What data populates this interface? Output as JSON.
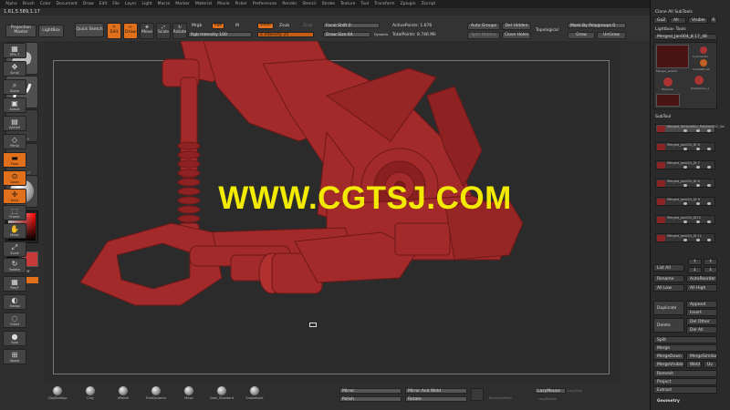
{
  "menu": [
    "Alpha",
    "Brush",
    "Color",
    "Document",
    "Draw",
    "Edit",
    "File",
    "Layer",
    "Light",
    "Macro",
    "Marker",
    "Material",
    "Movie",
    "Picker",
    "Preferences",
    "Render",
    "Stencil",
    "Stroke",
    "Texture",
    "Tool",
    "Transform",
    "Zplugin",
    "Zscript"
  ],
  "coords": "1.61,5.589,1.17",
  "top": {
    "projection_master": "Projection Master",
    "lightbox": "LightBox",
    "quick_sketch": "Quick Sketch",
    "edit": "Edit",
    "draw": "Draw",
    "move": "Move",
    "scale": "Scale",
    "rotate": "Rotate",
    "mrgb": "Mrgb",
    "rgb": "Rgb",
    "m": "M",
    "zadd": "Zadd",
    "zsub": "Zsub",
    "zcut": "Zcut",
    "rgb_intensity": "Rgb Intensity 100",
    "z_intensity": "Z Intensity 25",
    "focal_shift": "Focal Shift 0",
    "draw_size": "Draw Size 64",
    "dynamic": "Dynamic",
    "active_points": "ActivePoints: 1.676",
    "total_points": "TotalPoints: 8.746 Mil",
    "auto_groups": "Auto Groups",
    "split_hidden": "Split Hidden",
    "del_hidden": "Del Hidden",
    "close_holes": "Close Holes",
    "topological": "Topological",
    "mask_by_polygroups": "Mask By Polygroups 0",
    "grow": "Grow",
    "ungrow": "UnGrow"
  },
  "left": {
    "alpha_off": "Alpha Off",
    "texture_off": "Texture Off",
    "gradient": "Gradient",
    "switch_color": "SwitchColor",
    "alternate": "Alternate"
  },
  "watermark": "WWW.CGTSJ.COM",
  "right_shelf": [
    {
      "label": "SPix 3",
      "glyph": "▦",
      "active": false
    },
    {
      "label": "Scroll",
      "glyph": "✥",
      "active": false
    },
    {
      "label": "Zoom",
      "glyph": "⌕",
      "active": false
    },
    {
      "label": "Actual",
      "glyph": "▣",
      "active": false
    },
    {
      "label": "AAHalf",
      "glyph": "▤",
      "active": false
    },
    {
      "label": "Persp",
      "glyph": "◇",
      "active": false
    },
    {
      "label": "Floor",
      "glyph": "▬",
      "active": true
    },
    {
      "label": "Local",
      "glyph": "⊙",
      "active": true
    },
    {
      "label": "Gxyz",
      "glyph": "✛",
      "active": true
    },
    {
      "label": "Frame",
      "glyph": "⬚",
      "active": false
    },
    {
      "label": "Move",
      "glyph": "✋",
      "active": false
    },
    {
      "label": "Scale",
      "glyph": "⤢",
      "active": false
    },
    {
      "label": "Rotate",
      "glyph": "↻",
      "active": false
    },
    {
      "label": "PolyF",
      "glyph": "▦",
      "active": false
    },
    {
      "label": "Transp",
      "glyph": "◐",
      "active": false
    },
    {
      "label": "Ghost",
      "glyph": "◌",
      "active": false
    },
    {
      "label": "Solo",
      "glyph": "●",
      "active": false
    },
    {
      "label": "Xpose",
      "glyph": "⊞",
      "active": false
    }
  ],
  "panel": {
    "clone_all": "Clone All SubTools",
    "goz": "GoZ",
    "all": "All",
    "visible": "Visible",
    "r": "R",
    "lightbox_tools": "Lightbox› Tools",
    "current_tool": "Merged_Jan004_8.17_48",
    "tools": [
      "Merged_Jan004",
      "Cylinder3D",
      "ZSphere",
      "SimpleBrush",
      "PolySphere_1",
      "Merged_Jan004"
    ],
    "subtool": "SubTool",
    "subtools": [
      "Merged_VerticalSnr_Position002_Sel",
      "Merged_Jan004_DI 6",
      "Merged_Jan004_DI 7",
      "Merged_Jan004_DI 8",
      "Merged_Jan004_DI 9",
      "Merged_Jan004_Di10",
      "Merged_Jan004_DI 11"
    ],
    "list_all": "List All",
    "rename": "Rename",
    "auto_reorder": "AutoReorder",
    "all_low": "All Low",
    "all_high": "All High",
    "duplicate": "Duplicate",
    "append": "Append",
    "insert": "Insert",
    "delete": "Delete",
    "del_other": "Del Other",
    "del_all": "Del All",
    "split": "Split",
    "merge": "Merge",
    "merge_down": "MergeDown",
    "merge_similar": "MergeSimilar",
    "merge_visible": "MergeVisible",
    "weld": "Weld",
    "uv": "Uv",
    "remesh": "Remesh",
    "project": "Project",
    "extract": "Extract",
    "geometry": "Geometry"
  },
  "bottom": {
    "brushes": [
      "ClayBuildup",
      "Clay",
      "hPolish",
      "TrimDynamic",
      "Move",
      "Dam_Standard",
      "Snakehook"
    ],
    "mirror": "Mirror",
    "polish": "Polish",
    "mirror_and_weld": "Mirror And Weld",
    "rotate": "Rotate",
    "lazy_mouse": "LazyMouse",
    "lazy_radius": "LazyRadius",
    "lazy_step": "LazyStep",
    "stroke_label": "BackfaceMask"
  },
  "colors": {
    "accent": "#e0701c",
    "model": "#a32a2a",
    "watermark": "#f2ea00"
  }
}
